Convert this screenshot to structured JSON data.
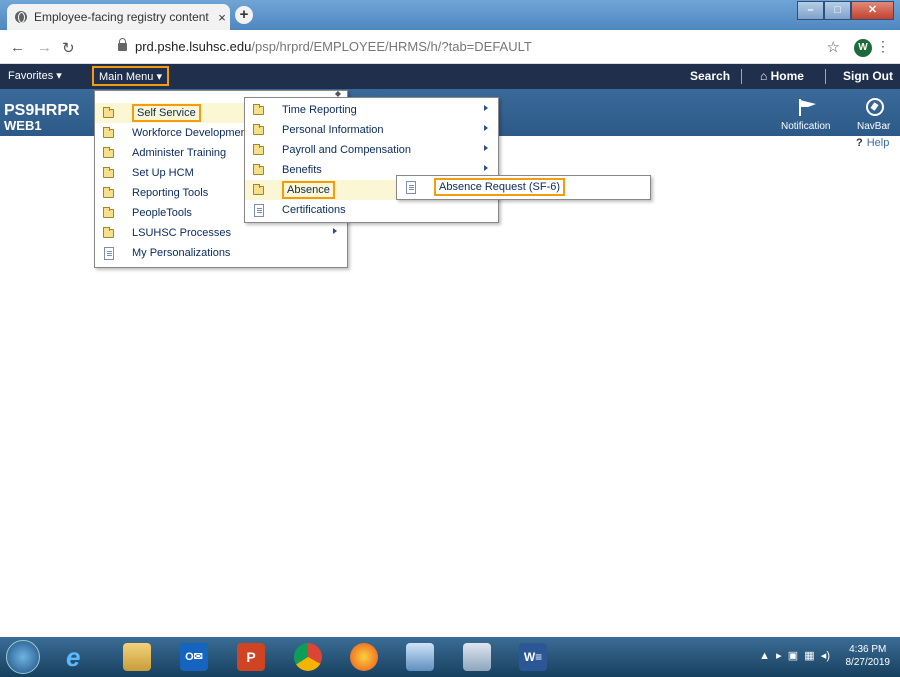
{
  "browser": {
    "tab_title": "Employee-facing registry content",
    "tab_close": "×",
    "new_tab": "+",
    "url_host": "prd.pshe.lsuhsc.edu",
    "url_path": "/psp/hrprd/EMPLOYEE/HRMS/h/?tab=DEFAULT",
    "profile_initial": "W"
  },
  "ps_header": {
    "favorites": "Favorites ▾",
    "main_menu": "Main Menu ▾",
    "search": "Search",
    "home": "Home",
    "sign_out": "Sign Out"
  },
  "banner": {
    "line1": "PS9HRPR",
    "line2": "WEB1",
    "notification": "Notification",
    "navbar": "NavBar",
    "help": "Help"
  },
  "main_menu_items": [
    {
      "label": "Self Service",
      "type": "folder",
      "highlighted": true,
      "outlined": true
    },
    {
      "label": "Workforce Developmen",
      "type": "folder"
    },
    {
      "label": "Administer Training",
      "type": "folder"
    },
    {
      "label": "Set Up HCM",
      "type": "folder"
    },
    {
      "label": "Reporting Tools",
      "type": "folder"
    },
    {
      "label": "PeopleTools",
      "type": "folder"
    },
    {
      "label": "LSUHSC Processes",
      "type": "folder",
      "arrow": true
    },
    {
      "label": "My Personalizations",
      "type": "doc"
    }
  ],
  "self_service_items": [
    {
      "label": "Time Reporting",
      "type": "folder",
      "arrow": true
    },
    {
      "label": "Personal Information",
      "type": "folder",
      "arrow": true
    },
    {
      "label": "Payroll and Compensation",
      "type": "folder",
      "arrow": true
    },
    {
      "label": "Benefits",
      "type": "folder",
      "arrow": true
    },
    {
      "label": "Absence",
      "type": "folder",
      "highlighted": true,
      "outlined": true
    },
    {
      "label": "Certifications",
      "type": "doc"
    }
  ],
  "absence_items": [
    {
      "label": "Absence Request (SF-6)",
      "type": "doc",
      "outlined": true
    }
  ],
  "taskbar": {
    "time": "4:36 PM",
    "date": "8/27/2019"
  },
  "colors": {
    "highlight_outline": "#f39c12",
    "ps_dark_bar": "#1f2f4c",
    "ps_blue_bar": "#2c5a88"
  }
}
